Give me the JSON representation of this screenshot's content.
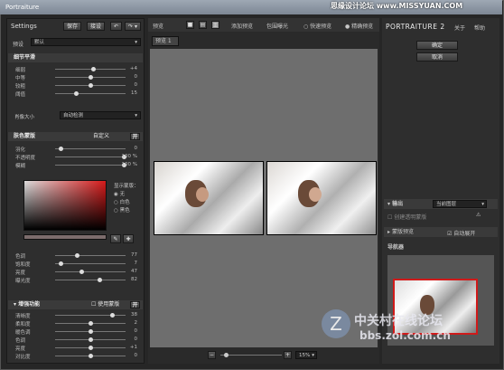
{
  "window": {
    "title": "Portraiture"
  },
  "watermark": {
    "text": "思缘设计论坛  www.MISSYUAN.COM"
  },
  "toolbar": {
    "settings_label": "Settings",
    "save": "保存",
    "load": "接设"
  },
  "preset": {
    "label": "预设",
    "value": "默认"
  },
  "detail": {
    "header": "细节平滑",
    "sliders": [
      {
        "label": "细弱",
        "value": "+4"
      },
      {
        "label": "中等",
        "value": "0"
      },
      {
        "label": "较粗",
        "value": "0"
      },
      {
        "label": "阈值",
        "value": "15"
      }
    ],
    "size_label": "肖像大小",
    "size_value": "自动检测"
  },
  "skin": {
    "header": "肤色蒙版",
    "mode": "自定义",
    "mode_btn": "开",
    "sliders": [
      {
        "label": "羽化",
        "value": "0"
      },
      {
        "label": "不透明度",
        "value": "100 %"
      },
      {
        "label": "模糊",
        "value": "100 %"
      }
    ],
    "display_label": "显示蒙版：",
    "options": [
      "无",
      "白色",
      "黑色"
    ],
    "hsv": [
      {
        "label": "色调",
        "value": "77"
      },
      {
        "label": "饱和度",
        "value": "7"
      },
      {
        "label": "亮度",
        "value": "47"
      },
      {
        "label": "曝光度",
        "value": "82"
      }
    ]
  },
  "enhance": {
    "header": "增强功能",
    "use_label": "使用蒙版",
    "sliders": [
      {
        "label": "清晰度",
        "value": "38"
      },
      {
        "label": "柔和度",
        "value": "2"
      },
      {
        "label": "暖色调",
        "value": "0"
      },
      {
        "label": "色调",
        "value": "0"
      },
      {
        "label": "亮度",
        "value": "+1"
      },
      {
        "label": "对比度",
        "value": "0"
      }
    ]
  },
  "center": {
    "preview_label": "预览",
    "add_preview": "添加预览",
    "exposure": "包围曝光",
    "fast_preview": "快速预览",
    "precise_preview": "精确预览",
    "tab": "预览 1",
    "zoom": "15%"
  },
  "right": {
    "brand": "PORTRAITURE 2",
    "about": "关于",
    "help": "帮助",
    "ok": "确定",
    "cancel": "取消",
    "output_label": "输出",
    "output_value": "当前图层",
    "new_layer": "创建透明蒙版",
    "mask_preview": "蒙版预览",
    "auto_expand": "自动展开",
    "navigator": "导航器"
  },
  "site_watermark": {
    "brand": "中关村在线论坛",
    "url": "bbs.zol.com.cn"
  }
}
